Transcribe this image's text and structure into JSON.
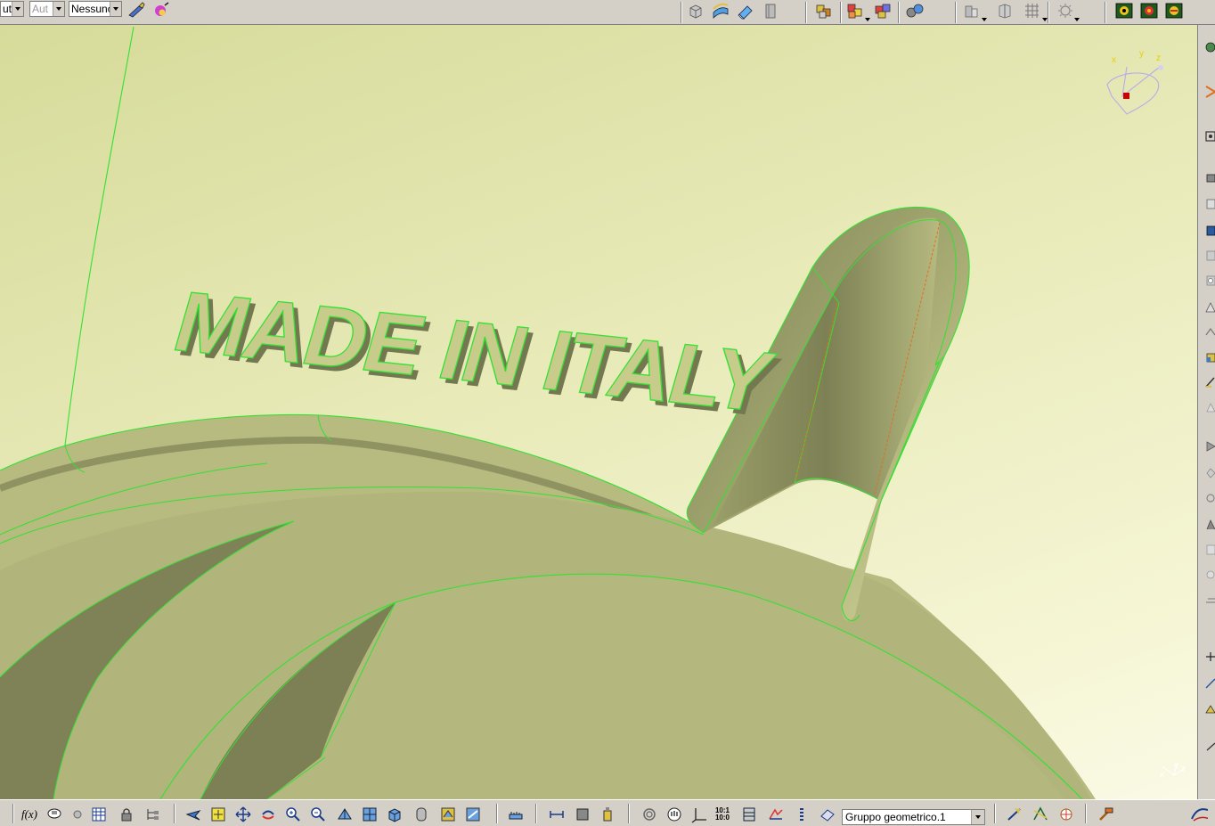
{
  "top_toolbar": {
    "combo_1_value": "ut",
    "combo_2_value": "Aut",
    "combo_3_value": "Nessuno"
  },
  "viewport": {
    "embossed_text": "MADE IN ITALY",
    "compass_axes": [
      "x",
      "y",
      "z"
    ],
    "triad_axes": [
      "x",
      "y",
      "z"
    ],
    "colors": {
      "background_dark": "#d6db9a",
      "background_light": "#fafae6",
      "part_face": "#b4b87e",
      "part_shadow": "#7e8256",
      "edge_green": "#33e033",
      "orange_edge": "#e07020"
    }
  },
  "bottom_toolbar": {
    "formula_label": "f(x)",
    "ratio_label_top": "10:1",
    "ratio_label_bottom": "10:0",
    "geometrical_set_value": "Gruppo geometrico.1"
  },
  "icons": {
    "top": [
      "cube-icon",
      "surface-icon",
      "eraser-icon",
      "page-icon",
      "multi-cube-icon",
      "color-cubes-icon",
      "colored-cubes-icon",
      "link-icon",
      "view-mode-icon",
      "parallel-view-icon",
      "grid-icon",
      "lamp-icon",
      "car-icon-1",
      "car-icon-2",
      "car-icon-3"
    ],
    "bottom": [
      "formula-icon",
      "comment-icon",
      "gear-icon",
      "table-icon",
      "lock-icon",
      "tree-icon",
      "fly-icon",
      "fit-all-icon",
      "pan-icon",
      "rotate-icon",
      "zoom-in-icon",
      "zoom-out-icon",
      "normal-view-icon",
      "multi-view-icon",
      "iso-view-icon",
      "shading-icon",
      "shading-edges-icon",
      "hide-show-icon",
      "measure-icon",
      "tool-icon",
      "bottle-icon",
      "spiral-icon",
      "hand-icon",
      "axis-icon",
      "scale-icon",
      "split-icon",
      "stack-icon",
      "folder-icon",
      "select-icon",
      "warp-icon",
      "sweep-icon",
      "sparkle-icon"
    ]
  }
}
